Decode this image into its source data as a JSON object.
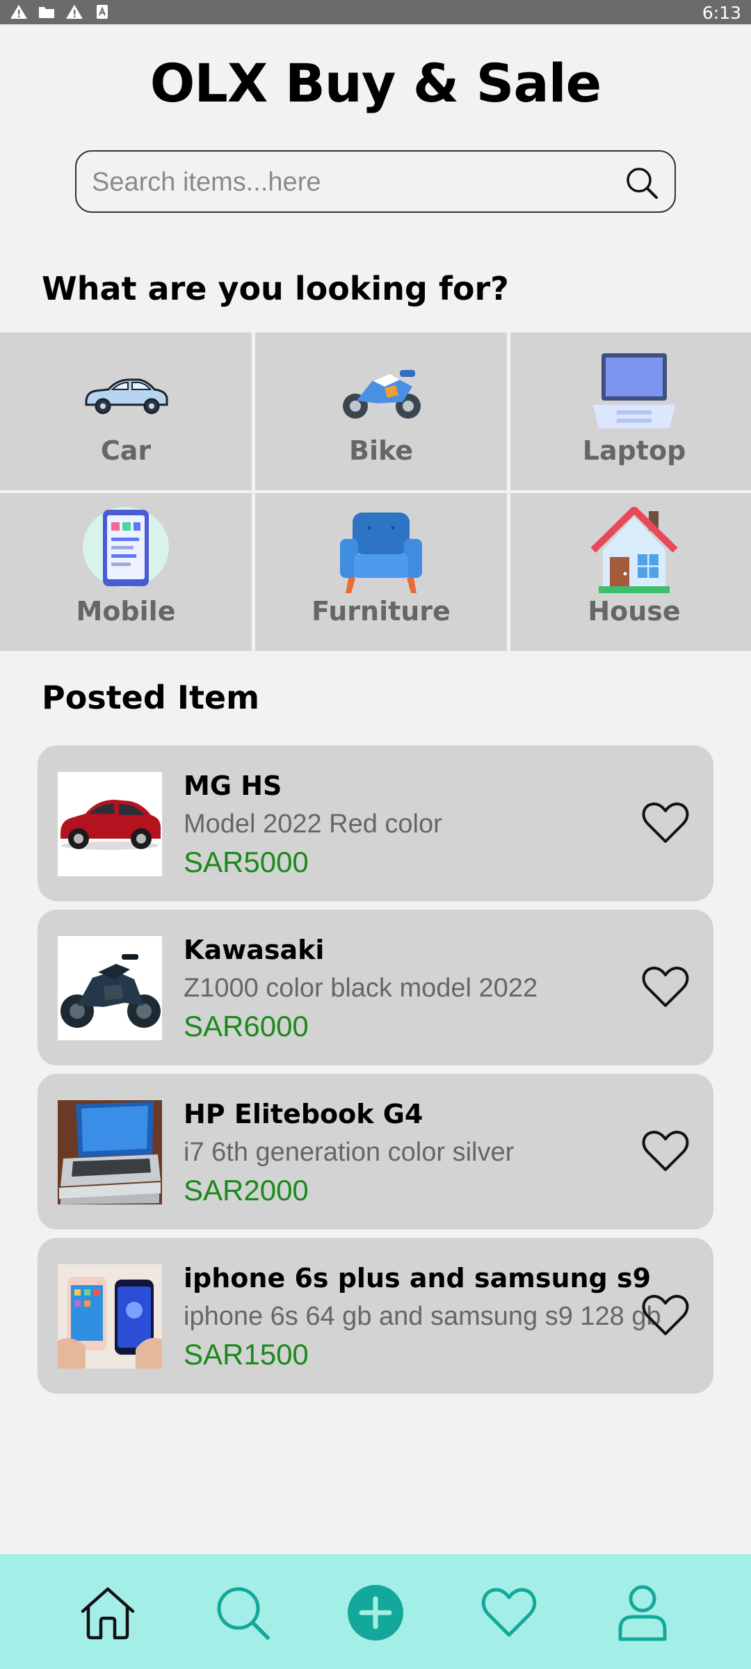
{
  "status_bar": {
    "time": "6:13",
    "icons": [
      "warning-icon",
      "folder-icon",
      "warning-icon",
      "sim-icon"
    ]
  },
  "header": {
    "title": "OLX Buy & Sale"
  },
  "search": {
    "placeholder": "Search items...here",
    "value": ""
  },
  "categories_section": {
    "title": "What are you looking for?",
    "items": [
      {
        "label": "Car",
        "icon": "car-icon"
      },
      {
        "label": "Bike",
        "icon": "motorbike-icon"
      },
      {
        "label": "Laptop",
        "icon": "laptop-icon"
      },
      {
        "label": "Mobile",
        "icon": "mobile-phone-icon"
      },
      {
        "label": "Furniture",
        "icon": "armchair-icon"
      },
      {
        "label": "House",
        "icon": "house-icon"
      }
    ]
  },
  "posted_section": {
    "title": "Posted Item",
    "items": [
      {
        "title": "MG HS",
        "description": "Model 2022 Red color",
        "price": "SAR5000",
        "image": "red-suv-photo"
      },
      {
        "title": "Kawasaki",
        "description": "Z1000 color black model 2022",
        "price": "SAR6000",
        "image": "black-motorcycle-photo"
      },
      {
        "title": "HP Elitebook G4",
        "description": "i7 6th generation color silver",
        "price": "SAR2000",
        "image": "laptop-photo"
      },
      {
        "title": "iphone 6s plus and samsung s9",
        "description": "iphone 6s 64 gb and samsung s9 128 gb",
        "price": "SAR1500",
        "image": "phones-photo"
      }
    ]
  },
  "bottom_nav": {
    "items": [
      "home-icon",
      "search-icon",
      "add-icon",
      "heart-icon",
      "profile-icon"
    ]
  },
  "colors": {
    "price": "#1a8a1a",
    "nav_background": "#a3efe7",
    "nav_accent": "#13a89a",
    "card_background": "#d3d3d3"
  }
}
